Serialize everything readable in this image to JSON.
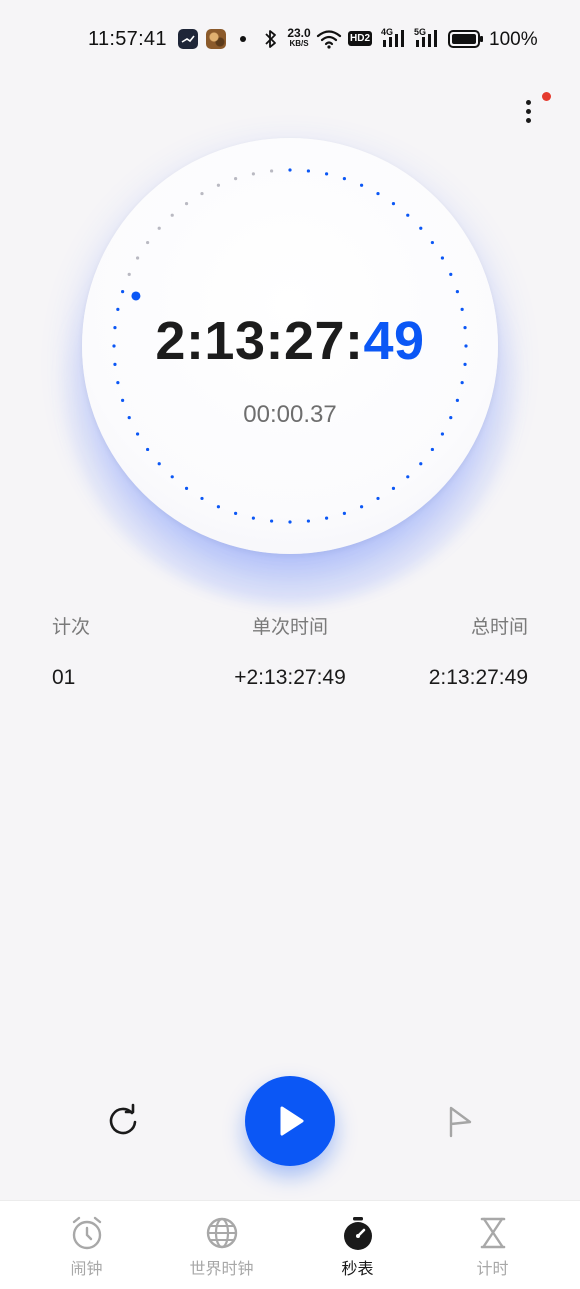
{
  "status_bar": {
    "time": "11:57:41",
    "net_speed_value": "23.0",
    "net_speed_unit": "KB/S",
    "hd_label": "HD2",
    "signal1_label": "4G",
    "signal2_label": "5G",
    "battery_text": "100%"
  },
  "stopwatch": {
    "main_time_prefix": "2:13:27:",
    "main_time_hundredths": "49",
    "current_lap_time": "00:00.37",
    "accent_color": "#0b57f5"
  },
  "lap_table": {
    "headers": {
      "count": "计次",
      "lap_time": "单次时间",
      "total_time": "总时间"
    },
    "rows": [
      {
        "index": "01",
        "lap_time": "+2:13:27:49",
        "total_time": "2:13:27:49"
      }
    ]
  },
  "controls": {
    "reset_icon": "reset-icon",
    "play_icon": "play-icon",
    "lap_icon": "flag-icon"
  },
  "bottom_nav": {
    "items": [
      {
        "label": "闹钟",
        "icon": "alarm-icon",
        "active": false
      },
      {
        "label": "世界时钟",
        "icon": "globe-icon",
        "active": false
      },
      {
        "label": "秒表",
        "icon": "stopwatch-icon",
        "active": true
      },
      {
        "label": "计时",
        "icon": "hourglass-icon",
        "active": false
      }
    ]
  }
}
